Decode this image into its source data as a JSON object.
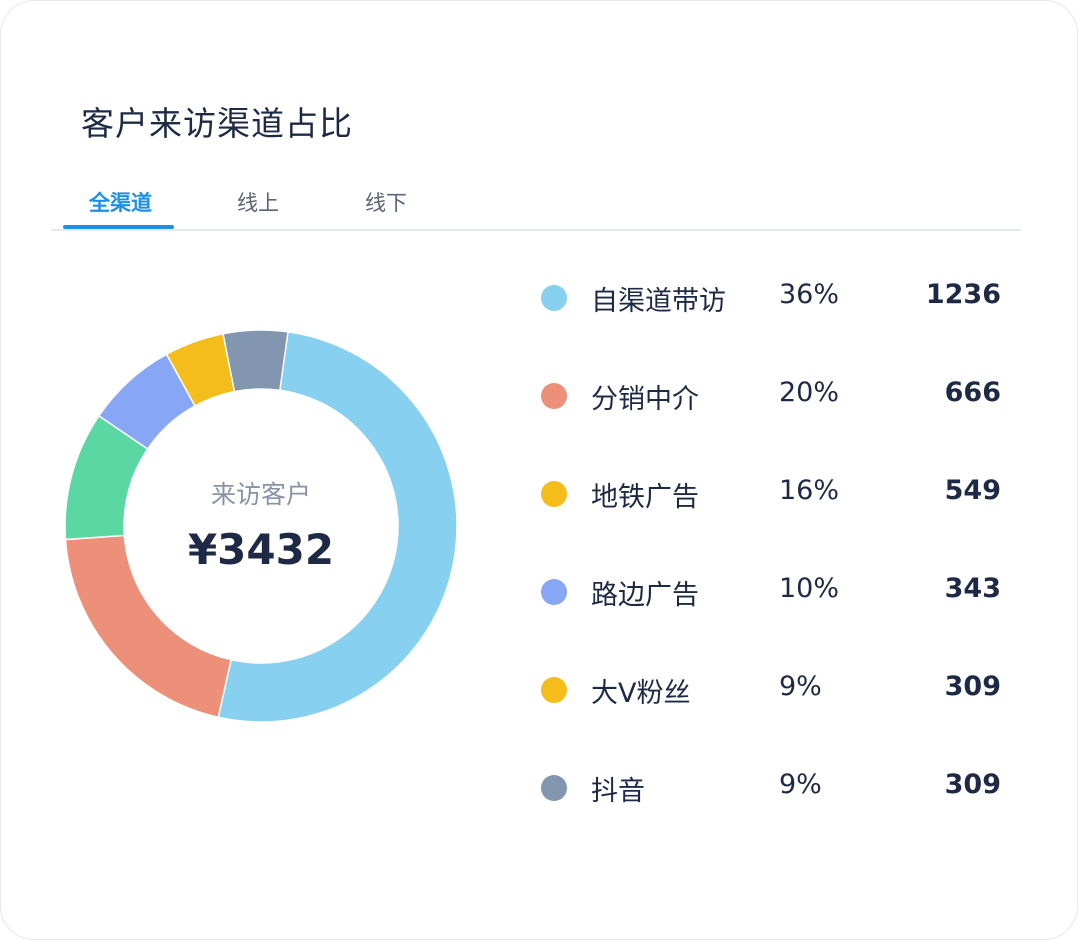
{
  "card": {
    "title": "客户来访渠道占比"
  },
  "tabs": [
    {
      "label": "全渠道",
      "active": true
    },
    {
      "label": "线上",
      "active": false
    },
    {
      "label": "线下",
      "active": false
    }
  ],
  "center": {
    "label": "来访客户",
    "value": "¥3432"
  },
  "colors": {
    "accent": "#1e8fe8",
    "text": "#1e2a45"
  },
  "chart_data": {
    "type": "pie",
    "donut": true,
    "categories": [
      "自渠道带访",
      "分销中介",
      "地铁广告",
      "路边广告",
      "大V粉丝",
      "抖音"
    ],
    "percent_labels": [
      "36%",
      "20%",
      "16%",
      "10%",
      "9%",
      "9%"
    ],
    "values": [
      1236,
      666,
      549,
      343,
      309,
      309
    ],
    "colors": [
      "#87d0f0",
      "#ec9079",
      "#5bd7a4",
      "#87a6f6",
      "#f5bd1c",
      "#8396b0"
    ],
    "legend_dot_colors": [
      "#87d0f0",
      "#ec9079",
      "#f5bd1c",
      "#87a6f6",
      "#f5bd1c",
      "#8396b0"
    ],
    "slice_fractions": [
      0.535,
      0.204,
      0.106,
      0.075,
      0.049,
      0.053
    ],
    "legend_position": "right"
  }
}
